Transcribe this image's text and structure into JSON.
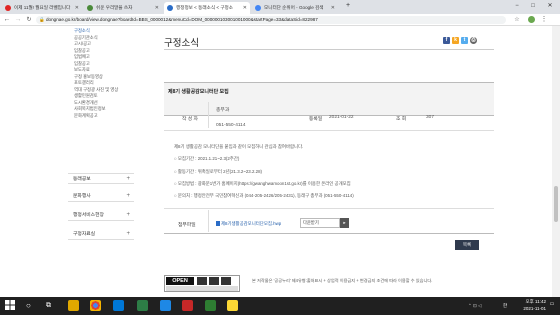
{
  "browser": {
    "tabs": [
      {
        "label": "이제 11월! 월요일 라벨입니다"
      },
      {
        "label": "쉬운 우리말을 쓰자"
      },
      {
        "label": "행정정보 < 동래소식 < 구정소"
      },
      {
        "label": "모니터단 순위어 - Google 검색"
      }
    ],
    "new_tab": "+",
    "url": "dongnae.go.kr/board/view.dongnae?boardId=BBS_0000012&menuCd=DOM_000000103001001000&startPage=33&dataSid=822987",
    "win_min": "−",
    "win_max": "□",
    "win_close": "✕"
  },
  "sidebar": {
    "sub_items": [
      "구정소식",
      "공공기관소식",
      "고시/공고",
      "입찰공고",
      "입법예고",
      "입찰공고",
      "보도자료",
      "구정 홍보동영상",
      "포토갤러리",
      "역대 구정광 사진 및 영상",
      "생활민원검토",
      "도시환경개선",
      "사회복지법인정보",
      "문화계획공고"
    ],
    "categories": [
      {
        "label": "동래공보"
      },
      {
        "label": "문화행사"
      },
      {
        "label": "행정서비스헌장"
      },
      {
        "label": "구정자료실"
      }
    ]
  },
  "content": {
    "page_title": "구정소식",
    "post_title": "제8기 생활공감모니터단 모집",
    "meta": {
      "author_label": "작 성 자",
      "author_value": "총무과",
      "phone_value": "051-550-4114",
      "date_label": "등록일",
      "date_value": "2021-01-22",
      "views_label": "조 회",
      "views_value": "307"
    },
    "body_lines": [
      "제8기 생활공감 모니터단을 붙임과 같이 모집하니 관심과 참여바랍니다.",
      "○ 모집기간 : 2021.1.21~2.3(2주간)",
      "○ 활동기간 : 위촉일로부터 2년(21.3.2~23.2.28)",
      "○ 모집방법 : 광화문1번가 홈페이지(https://gwanghwamoon1st.go.kr)를 이용한 온라인 공개모집",
      "○ 문의처 : 행정안전부 국민참여혁신과 (044-205-2426/205-2431), 동래구 총무과 (051-550-4114)"
    ],
    "attachment_label": "첨부파일",
    "attachment_file": "제8기생활공감모니터단모집.hwp",
    "download_label": "다운받기",
    "list_button": "목록"
  },
  "footer": {
    "open_badge": "OPEN",
    "notice": "본 저작물은 '공공누리' 제4유형:출처표시 + 상업적 이용금지 + 변경금지 조건에 따라 이용할 수 있습니다."
  },
  "taskbar": {
    "lang": "한",
    "time": "오후 11:42",
    "date": "2021-11-01"
  }
}
